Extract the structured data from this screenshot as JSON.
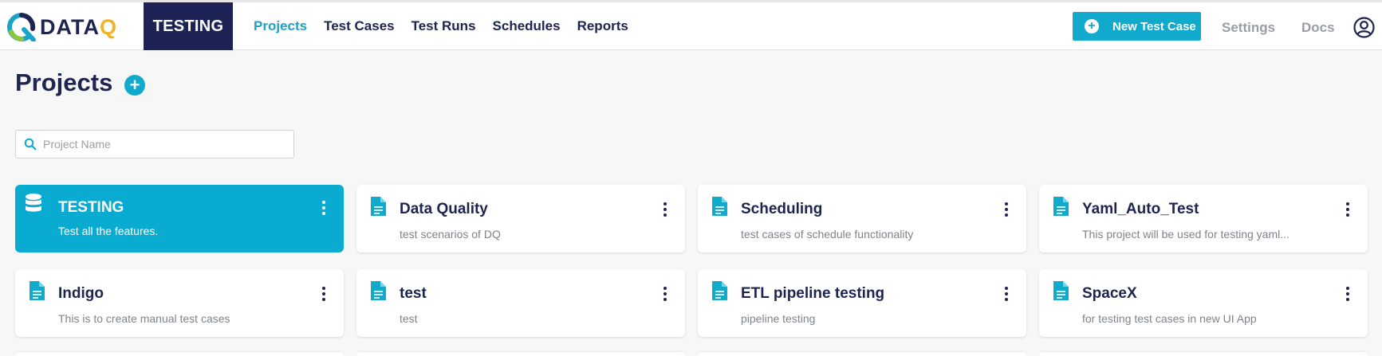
{
  "app": {
    "logo_text_main": "DATA",
    "logo_text_accent": "Q",
    "workspace": "TESTING"
  },
  "nav": {
    "items": [
      {
        "label": "Projects",
        "active": true
      },
      {
        "label": "Test Cases",
        "active": false
      },
      {
        "label": "Test Runs",
        "active": false
      },
      {
        "label": "Schedules",
        "active": false
      },
      {
        "label": "Reports",
        "active": false
      }
    ]
  },
  "header": {
    "new_test_case": "New Test Case",
    "settings": "Settings",
    "docs": "Docs"
  },
  "page": {
    "title": "Projects",
    "search_placeholder": "Project Name"
  },
  "projects": [
    {
      "name": "TESTING",
      "description": "Test all the features.",
      "selected": true,
      "icon": "database-icon"
    },
    {
      "name": "Data Quality",
      "description": "test scenarios of DQ",
      "selected": false,
      "icon": "document-icon"
    },
    {
      "name": "Scheduling",
      "description": "test cases of schedule functionality",
      "selected": false,
      "icon": "document-icon"
    },
    {
      "name": "Yaml_Auto_Test",
      "description": "This project will be used for testing yaml...",
      "selected": false,
      "icon": "document-icon"
    },
    {
      "name": "Indigo",
      "description": "This is to create manual test cases",
      "selected": false,
      "icon": "document-icon"
    },
    {
      "name": "test",
      "description": "test",
      "selected": false,
      "icon": "document-icon"
    },
    {
      "name": "ETL pipeline testing",
      "description": "pipeline testing",
      "selected": false,
      "icon": "document-icon"
    },
    {
      "name": "SpaceX",
      "description": "for testing test cases in new UI App",
      "selected": false,
      "icon": "document-icon"
    }
  ],
  "colors": {
    "accent": "#11a9cc",
    "navy": "#1e2356",
    "logo_yellow": "#f2b322",
    "logo_green": "#8cc63f"
  }
}
